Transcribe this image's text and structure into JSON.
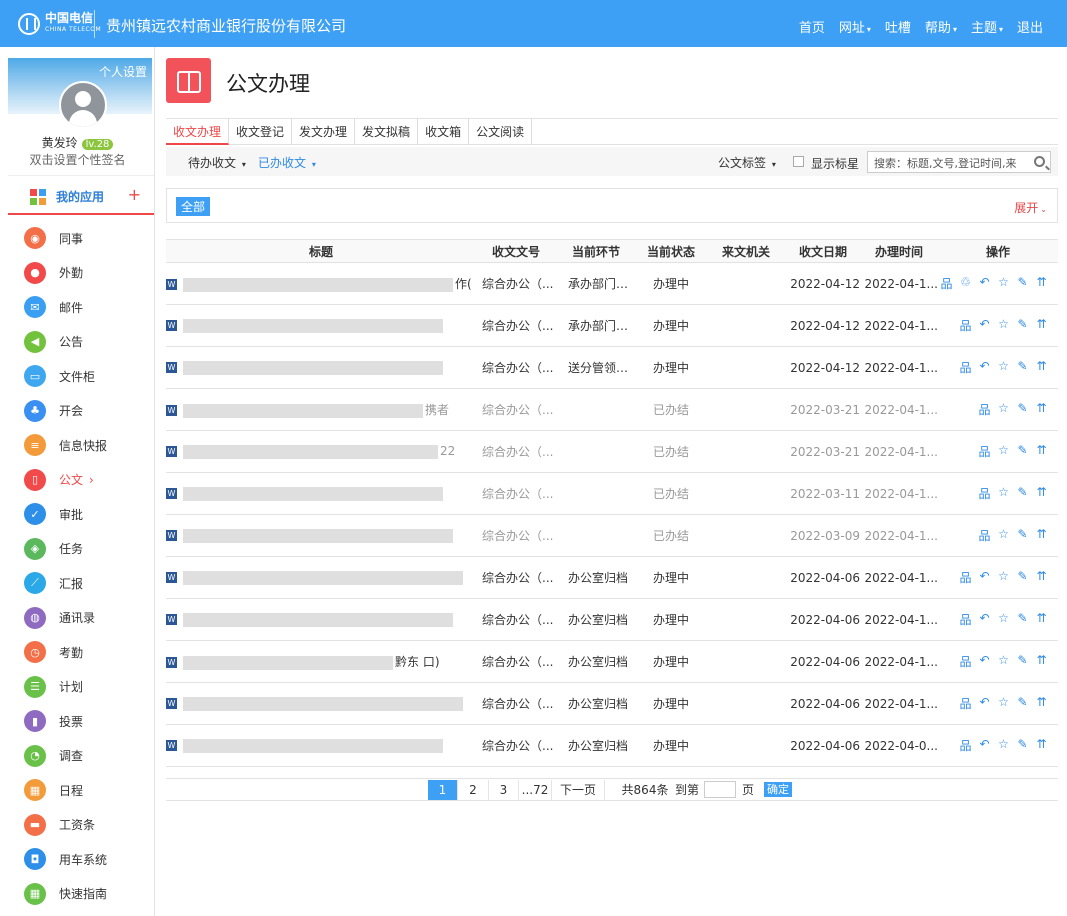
{
  "header": {
    "logo_cn": "中国电信",
    "logo_en": "CHINA TELECOM",
    "company": "贵州镇远农村商业银行股份有限公司",
    "nav": [
      "首页",
      "网址",
      "吐槽",
      "帮助",
      "主题",
      "退出"
    ]
  },
  "profile": {
    "settings": "个人设置",
    "name": "黄发玲",
    "level": "lv.28",
    "signature": "双击设置个性签名"
  },
  "sidebar": {
    "myapps": "我的应用",
    "plus": "+",
    "items": [
      {
        "label": "同事",
        "icon": "colleague-icon",
        "color": "#f36f48"
      },
      {
        "label": "外勤",
        "icon": "location-icon",
        "color": "#f24a4a"
      },
      {
        "label": "邮件",
        "icon": "mail-icon",
        "color": "#3a9ff2"
      },
      {
        "label": "公告",
        "icon": "announcement-icon",
        "color": "#73c23d"
      },
      {
        "label": "文件柜",
        "icon": "folder-icon",
        "color": "#3ea7ef"
      },
      {
        "label": "开会",
        "icon": "meeting-icon",
        "color": "#3a8ff2"
      },
      {
        "label": "信息快报",
        "icon": "news-icon",
        "color": "#f39a3a"
      },
      {
        "label": "公文",
        "icon": "document-icon",
        "color": "#f24a4a"
      },
      {
        "label": "审批",
        "icon": "approval-icon",
        "color": "#2d8fe8"
      },
      {
        "label": "任务",
        "icon": "task-icon",
        "color": "#5cb85c"
      },
      {
        "label": "汇报",
        "icon": "report-icon",
        "color": "#2ba8e8"
      },
      {
        "label": "通讯录",
        "icon": "contacts-icon",
        "color": "#8e6bc0"
      },
      {
        "label": "考勤",
        "icon": "clock-icon",
        "color": "#f36f48"
      },
      {
        "label": "计划",
        "icon": "plan-icon",
        "color": "#6ac14a"
      },
      {
        "label": "投票",
        "icon": "vote-icon",
        "color": "#8e6bc0"
      },
      {
        "label": "调查",
        "icon": "survey-icon",
        "color": "#6ac14a"
      },
      {
        "label": "日程",
        "icon": "calendar-icon",
        "color": "#f39a3a"
      },
      {
        "label": "工资条",
        "icon": "salary-icon",
        "color": "#f36f48"
      },
      {
        "label": "用车系统",
        "icon": "car-icon",
        "color": "#2d8fe8"
      },
      {
        "label": "快速指南",
        "icon": "guide-icon",
        "color": "#6ac14a"
      }
    ],
    "active_index": 7,
    "active_arrow": "›"
  },
  "page": {
    "title": "公文办理"
  },
  "tabs": [
    "收文办理",
    "收文登记",
    "发文办理",
    "发文拟稿",
    "收文箱",
    "公文阅读"
  ],
  "subbar": {
    "pending": "待办收文",
    "done": "已办收文",
    "tags": "公文标签",
    "star": "显示标星",
    "search_placeholder": "搜索：标题,文号,登记时间,来"
  },
  "filter": {
    "all": "全部",
    "expand": "展开"
  },
  "table": {
    "headers": [
      "标题",
      "收文文号",
      "当前环节",
      "当前状态",
      "来文机关",
      "收文日期",
      "办理时间",
      "操作"
    ],
    "rows": [
      {
        "title_fragment": "作(",
        "doc_no": "综合办公（...",
        "step": "承办部门办...",
        "status": "办理中",
        "agency": "",
        "date": "2022-04-12",
        "handle": "2022-04-1...",
        "done": false,
        "ops": [
          "org",
          "recycle",
          "undo",
          "star",
          "edit",
          "top"
        ]
      },
      {
        "title_fragment": "",
        "doc_no": "综合办公（...",
        "step": "承办部门办...",
        "status": "办理中",
        "agency": "",
        "date": "2022-04-12",
        "handle": "2022-04-1...",
        "done": false,
        "ops": [
          "org",
          "undo",
          "star",
          "edit",
          "top"
        ]
      },
      {
        "title_fragment": "",
        "doc_no": "综合办公（...",
        "step": "送分管领导...",
        "status": "办理中",
        "agency": "",
        "date": "2022-04-12",
        "handle": "2022-04-1...",
        "done": false,
        "ops": [
          "org",
          "undo",
          "star",
          "edit",
          "top"
        ]
      },
      {
        "title_fragment": "携者",
        "doc_no": "综合办公（...",
        "step": "",
        "status": "已办结",
        "agency": "",
        "date": "2022-03-21",
        "handle": "2022-04-1...",
        "done": true,
        "ops": [
          "org",
          "star",
          "edit",
          "top"
        ]
      },
      {
        "title_fragment": "22",
        "doc_no": "综合办公（...",
        "step": "",
        "status": "已办结",
        "agency": "",
        "date": "2022-03-21",
        "handle": "2022-04-1...",
        "done": true,
        "ops": [
          "org",
          "star",
          "edit",
          "top"
        ]
      },
      {
        "title_fragment": "",
        "doc_no": "综合办公（...",
        "step": "",
        "status": "已办结",
        "agency": "",
        "date": "2022-03-11",
        "handle": "2022-04-1...",
        "done": true,
        "ops": [
          "org",
          "star",
          "edit",
          "top"
        ]
      },
      {
        "title_fragment": "",
        "doc_no": "综合办公（...",
        "step": "",
        "status": "已办结",
        "agency": "",
        "date": "2022-03-09",
        "handle": "2022-04-1...",
        "done": true,
        "ops": [
          "org",
          "star",
          "edit",
          "top"
        ]
      },
      {
        "title_fragment": "",
        "doc_no": "综合办公（...",
        "step": "办公室归档",
        "status": "办理中",
        "agency": "",
        "date": "2022-04-06",
        "handle": "2022-04-1...",
        "done": false,
        "ops": [
          "org",
          "undo",
          "star",
          "edit",
          "top"
        ]
      },
      {
        "title_fragment": "",
        "doc_no": "综合办公（...",
        "step": "办公室归档",
        "status": "办理中",
        "agency": "",
        "date": "2022-04-06",
        "handle": "2022-04-1...",
        "done": false,
        "ops": [
          "org",
          "undo",
          "star",
          "edit",
          "top"
        ]
      },
      {
        "title_fragment": "黔东 口)",
        "doc_no": "综合办公（...",
        "step": "办公室归档",
        "status": "办理中",
        "agency": "",
        "date": "2022-04-06",
        "handle": "2022-04-1...",
        "done": false,
        "ops": [
          "org",
          "undo",
          "star",
          "edit",
          "top"
        ]
      },
      {
        "title_fragment": "",
        "doc_no": "综合办公（...",
        "step": "办公室归档",
        "status": "办理中",
        "agency": "",
        "date": "2022-04-06",
        "handle": "2022-04-1...",
        "done": false,
        "ops": [
          "org",
          "undo",
          "star",
          "edit",
          "top"
        ]
      },
      {
        "title_fragment": "",
        "doc_no": "综合办公（...",
        "step": "办公室归档",
        "status": "办理中",
        "agency": "",
        "date": "2022-04-06",
        "handle": "2022-04-0...",
        "done": false,
        "ops": [
          "org",
          "undo",
          "star",
          "edit",
          "top"
        ]
      }
    ]
  },
  "pager": {
    "pages": [
      "1",
      "2",
      "3",
      "...72"
    ],
    "next": "下一页",
    "total": "共864条",
    "goto": "到第",
    "page_unit": "页",
    "ok": "确定"
  },
  "colors": {
    "accent": "#3ea0f4",
    "danger": "#f04848",
    "link": "#2f8be6"
  }
}
